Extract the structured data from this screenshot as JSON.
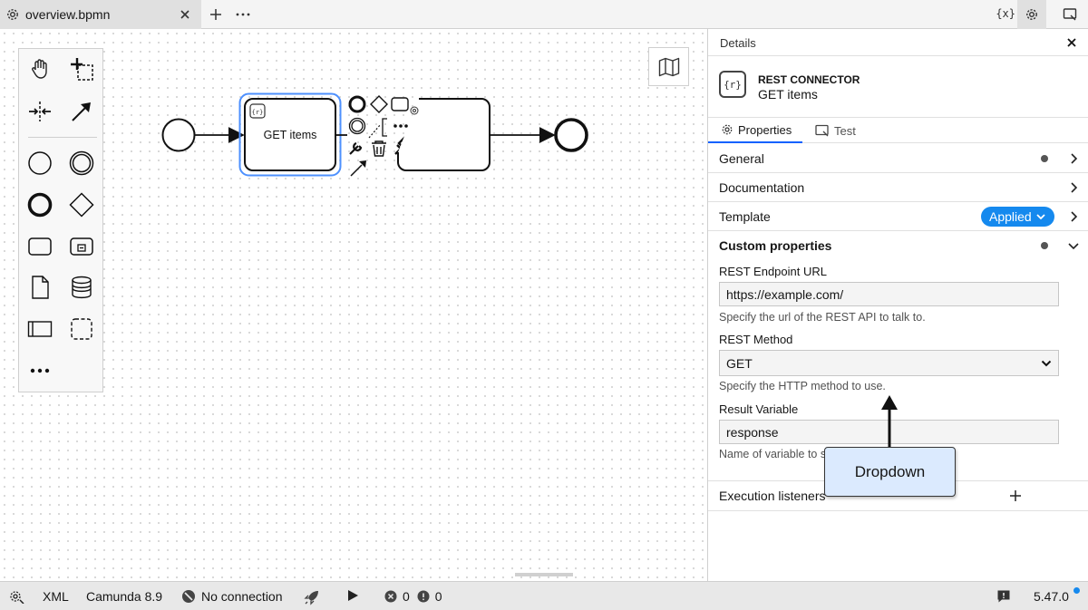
{
  "tab": {
    "title": "overview.bpmn",
    "icon": "gear-icon",
    "close_icon": "close-icon"
  },
  "toolbar": {
    "add_icon": "plus-icon",
    "more_icon": "ellipsis-icon",
    "variables_label": "{x}",
    "settings_icon": "gear-icon",
    "panel_icon": "panel-toggle-icon"
  },
  "palette": {
    "items": [
      {
        "name": "hand-tool-icon"
      },
      {
        "name": "lasso-tool-icon"
      },
      {
        "name": "space-tool-icon"
      },
      {
        "name": "global-connect-tool-icon"
      },
      {
        "name": "start-event-icon"
      },
      {
        "name": "intermediate-event-icon"
      },
      {
        "name": "end-event-icon"
      },
      {
        "name": "gateway-icon"
      },
      {
        "name": "task-icon"
      },
      {
        "name": "subprocess-icon"
      },
      {
        "name": "data-object-icon"
      },
      {
        "name": "data-store-icon"
      },
      {
        "name": "pool-icon"
      },
      {
        "name": "group-icon"
      },
      {
        "name": "more-icon"
      }
    ]
  },
  "diagram": {
    "task_label": "GET items",
    "task_badge": "{r}"
  },
  "panel": {
    "title": "Details",
    "element_type": "REST CONNECTOR",
    "element_name": "GET items",
    "element_badge": "{r}",
    "tabs": [
      {
        "label": "Properties",
        "active": true
      },
      {
        "label": "Test",
        "active": false
      }
    ],
    "groups": {
      "general": "General",
      "documentation": "Documentation",
      "template": "Template",
      "template_badge": "Applied",
      "custom": "Custom properties"
    },
    "fields": {
      "url_label": "REST Endpoint URL",
      "url_value": "https://example.com/",
      "url_help": "Specify the url of the REST API to talk to.",
      "method_label": "REST Method",
      "method_value": "GET",
      "method_help": "Specify the HTTP method to use.",
      "result_label": "Result Variable",
      "result_value": "response",
      "result_help": "Name of variable to store the response data in."
    },
    "execution_listeners": "Execution listeners"
  },
  "annotation": {
    "label": "Dropdown"
  },
  "statusbar": {
    "xml": "XML",
    "engine": "Camunda 8.9",
    "connection": "No connection",
    "errors": "0",
    "warnings": "0",
    "version": "5.47.0"
  },
  "colors": {
    "accent": "#1589ee",
    "selection": "#4d90fe",
    "annotation_bg": "#dbeafe"
  }
}
